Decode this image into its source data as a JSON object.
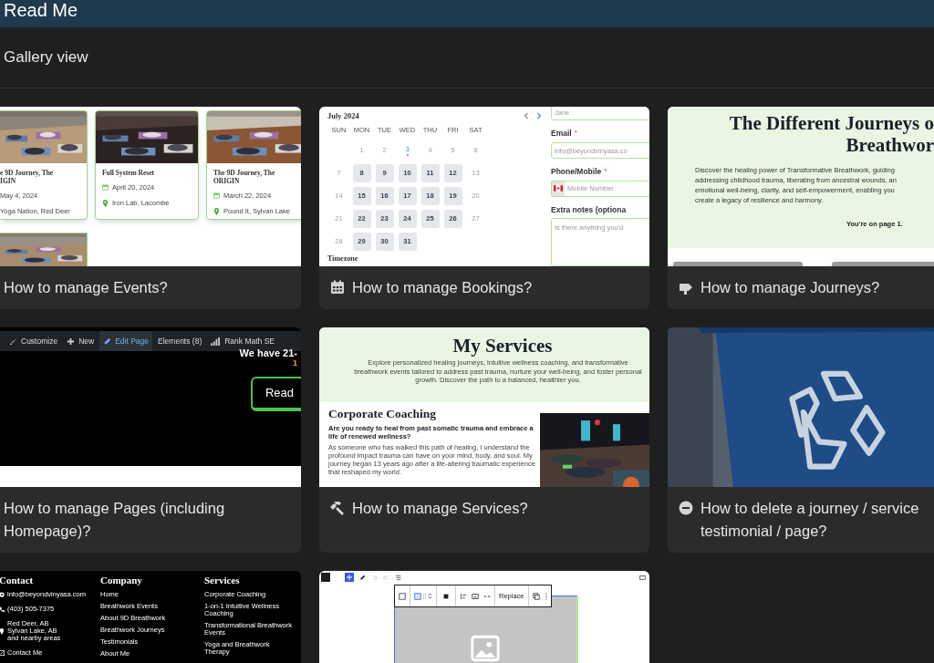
{
  "header": {
    "title": "Read Me"
  },
  "view": {
    "title": "Gallery view"
  },
  "cards": [
    {
      "title": "How to manage Events?",
      "preview": {
        "kind": "events",
        "events": [
          {
            "title": "e 9D Journey, The\nIGIN",
            "date": "May 4, 2024",
            "location": "Yoga Nation, Red Deer",
            "partial": true
          },
          {
            "title": "Full System Reset",
            "date": "April 20, 2024",
            "location": "Iron Lab, Lacombe",
            "partial": false
          },
          {
            "title": "The 9D Journey, The ORIGIN",
            "date": "March 22, 2024",
            "location": "Pound It, Sylvan Lake",
            "partial": false
          }
        ]
      }
    },
    {
      "title": "How to manage Bookings?",
      "preview": {
        "kind": "calendar",
        "month": "July 2024",
        "weekdays": [
          "SUN",
          "MON",
          "TUE",
          "WED",
          "THU",
          "FRI",
          "SAT"
        ],
        "weeks": [
          [
            {
              "day": "1",
              "available": false,
              "today": false
            },
            {
              "day": "2",
              "available": false,
              "today": false
            },
            {
              "day": "3",
              "available": false,
              "today": true
            },
            {
              "day": "4",
              "available": false,
              "today": false
            },
            {
              "day": "5",
              "available": false,
              "today": false
            },
            {
              "day": "6",
              "available": false,
              "today": false
            }
          ],
          [
            {
              "day": "7",
              "available": false,
              "today": false
            },
            {
              "day": "8",
              "available": true,
              "today": false
            },
            {
              "day": "9",
              "available": true,
              "today": false
            },
            {
              "day": "10",
              "available": true,
              "today": false
            },
            {
              "day": "11",
              "available": true,
              "today": false
            },
            {
              "day": "12",
              "available": true,
              "today": false
            },
            {
              "day": "13",
              "available": false,
              "today": false
            }
          ],
          [
            {
              "day": "14",
              "available": false,
              "today": false
            },
            {
              "day": "15",
              "available": true,
              "today": false
            },
            {
              "day": "16",
              "available": true,
              "today": false
            },
            {
              "day": "17",
              "available": true,
              "today": false
            },
            {
              "day": "18",
              "available": true,
              "today": false
            },
            {
              "day": "19",
              "available": true,
              "today": false
            },
            {
              "day": "20",
              "available": false,
              "today": false
            }
          ],
          [
            {
              "day": "21",
              "available": false,
              "today": false
            },
            {
              "day": "22",
              "available": true,
              "today": false
            },
            {
              "day": "23",
              "available": true,
              "today": false
            },
            {
              "day": "24",
              "available": true,
              "today": false
            },
            {
              "day": "25",
              "available": true,
              "today": false
            },
            {
              "day": "26",
              "available": true,
              "today": false
            },
            {
              "day": "27",
              "available": false,
              "today": false
            }
          ],
          [
            {
              "day": "28",
              "available": false,
              "today": false
            },
            {
              "day": "29",
              "available": true,
              "today": false
            },
            {
              "day": "30",
              "available": true,
              "today": false
            },
            {
              "day": "31",
              "available": true,
              "today": false
            }
          ]
        ],
        "timezone_label": "Timezone",
        "fields": [
          {
            "kind": "text",
            "placeholder": "Jane"
          },
          {
            "kind": "text",
            "label": "Email",
            "required_mark": "*",
            "placeholder": "info@beyondvinyasa.co"
          },
          {
            "kind": "phone",
            "label": "Phone/Mobile",
            "required_mark": "*",
            "placeholder": "Mobile Number"
          },
          {
            "kind": "textarea",
            "label": "Extra notes (optiona",
            "placeholder": "Is there anything you'd"
          }
        ]
      }
    },
    {
      "title": "How to manage Journeys?",
      "preview": {
        "kind": "journeys",
        "heading_lines": [
          "The Different Journeys o",
          "Breathwor"
        ],
        "paragraph_lines": [
          "Discover the healing power of Transformative Breathwork, guiding",
          "addressing childhood trauma, liberating from ancestral wounds, an",
          "emotional well-being, clarity, and self-empowerment, enabling you",
          "create a legacy of resilience and harmony."
        ],
        "page_note": "You're on page 1."
      }
    },
    {
      "title": "How to manage Pages (including Homepage)?",
      "preview": {
        "kind": "pages",
        "admin_bar": [
          {
            "label": "Customize",
            "selected": false
          },
          {
            "label": "New",
            "selected": false
          },
          {
            "label": "Edit Page",
            "selected": true
          },
          {
            "label": "Elements (8)",
            "selected": false
          },
          {
            "label": "Rank Math SE",
            "selected": false
          }
        ],
        "banner_text": "We have 21-",
        "accent_text": "1",
        "button_label": "Read"
      }
    },
    {
      "title": "How to manage Services?",
      "preview": {
        "kind": "services",
        "heading": "My Services",
        "intro": "Explore personalized healing journeys, intuitive wellness coaching, and transformative breathwork events tailored to address past trauma, nurture your well-being, and foster personal growth. Discover the path to a balanced, healthier you.",
        "section_title": "Corporate Coaching",
        "question": "Are you ready to heal from past somatic trauma and embrace a life of renewed wellness?",
        "body": "As someone who has walked this path of healing, I understand the profound impact trauma can have on your mind, body, and soul. My journey began 13 years ago after a life-altering traumatic experience that reshaped my world."
      }
    },
    {
      "title": "How to delete a journey / service testimonial / page?"
    },
    {
      "preview": {
        "kind": "footer",
        "columns": [
          {
            "heading": "Contact",
            "items": [
              {
                "text": "info@beyondvinyasa.com",
                "kind": "email"
              },
              {
                "text": "(403) 505-7375",
                "kind": "phone"
              },
              {
                "text": "Red Deer, AB\nSylvan Lake, AB\nand nearby areas",
                "kind": "address"
              },
              {
                "text": "Contact Me",
                "kind": "form"
              }
            ]
          },
          {
            "heading": "Company",
            "items": [
              {
                "text": "Home",
                "kind": "link"
              },
              {
                "text": "Breathwork Events",
                "kind": "link"
              },
              {
                "text": "About 9D Breathwork",
                "kind": "link"
              },
              {
                "text": "Breathwork Journeys",
                "kind": "link"
              },
              {
                "text": "Testimonials",
                "kind": "link"
              },
              {
                "text": "About Me",
                "kind": "link"
              }
            ]
          },
          {
            "heading": "Services",
            "items": [
              {
                "text": "Corporate Coaching",
                "kind": "link"
              },
              {
                "text": "1-on-1 Intuitive Wellness Coaching",
                "kind": "link"
              },
              {
                "text": "Transformational Breathwork Events",
                "kind": "link"
              },
              {
                "text": "Yoga and Breathwork Therapy",
                "kind": "link"
              }
            ]
          }
        ]
      }
    },
    {
      "preview": {
        "kind": "editor",
        "replace_label": "Replace"
      }
    }
  ]
}
